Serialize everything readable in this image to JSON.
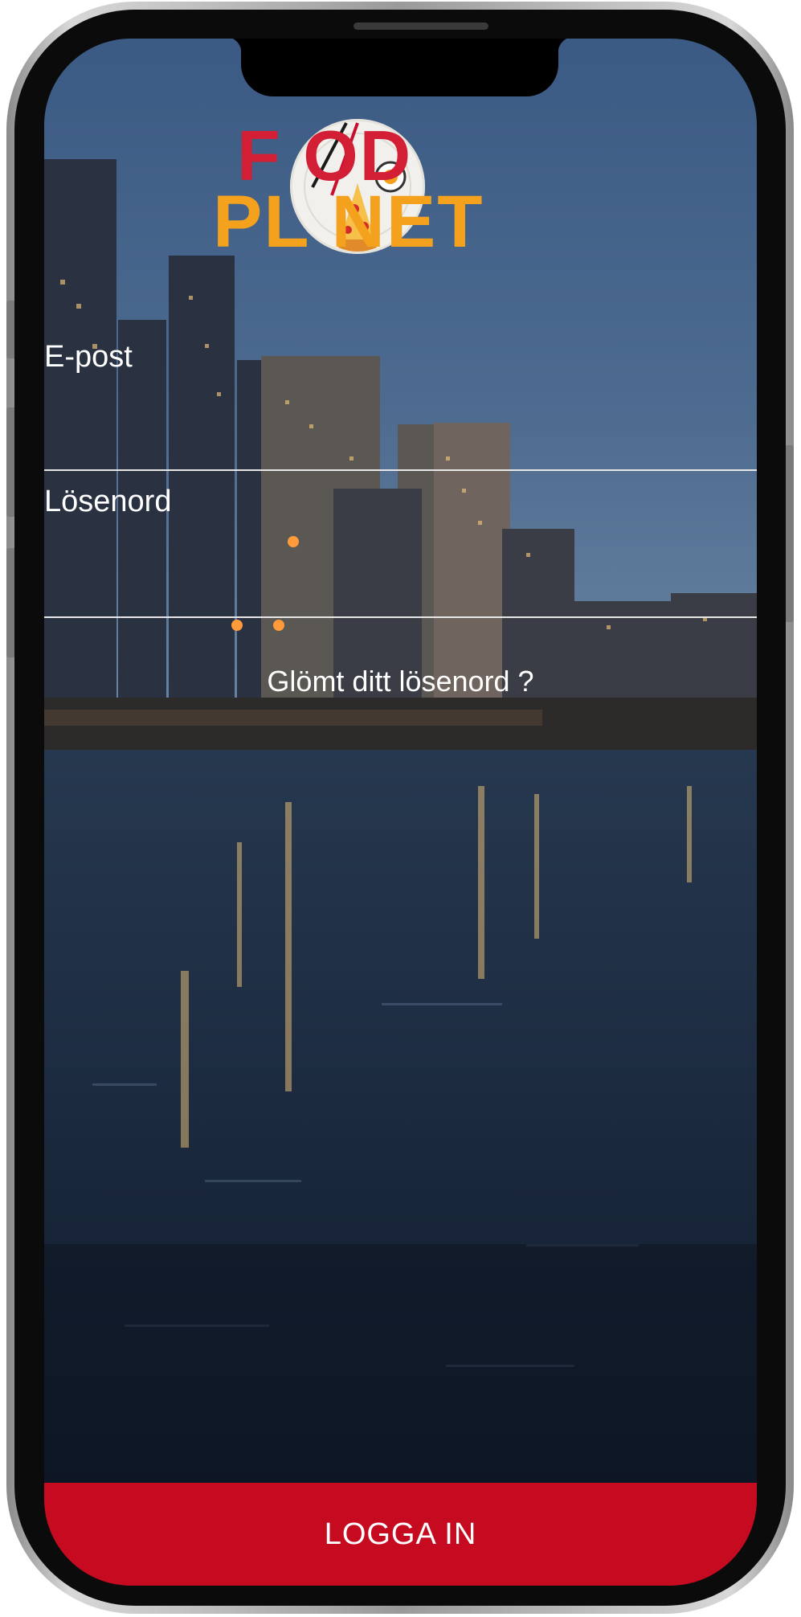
{
  "app": {
    "logo": {
      "line1": "F  OD",
      "line2": "PL  NET",
      "brand": "FOOD PLANET",
      "colors": {
        "food": "#d21f36",
        "planet": "#f4a21d"
      }
    }
  },
  "login": {
    "email": {
      "label": "E-post",
      "value": ""
    },
    "password": {
      "label": "Lösenord",
      "value": ""
    },
    "forgot_password": "Glömt ditt lösenord ?",
    "submit_label": "LOGGA IN"
  },
  "theme": {
    "accent": "#c60a1f",
    "text": "#ffffff"
  }
}
